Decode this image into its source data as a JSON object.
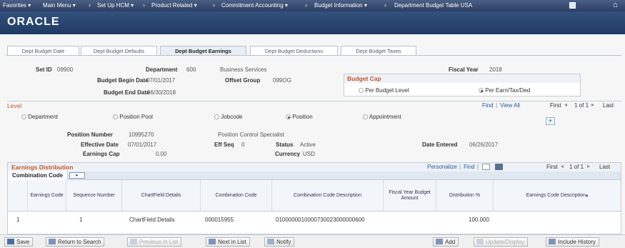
{
  "nav": {
    "favorites": "Favorites",
    "main_menu": "Main Menu",
    "setup_hcm": "Set Up HCM",
    "product_related": "Product Related",
    "commitment_accounting": "Commitment Accounting",
    "budget_information": "Budget Information",
    "department_budget_table": "Department Budget Table USA"
  },
  "brand": {
    "logo": "ORACLE"
  },
  "tabs": [
    "Dept Budget Date",
    "Dept Budget Defaults",
    "Dept Budget Earnings",
    "Dept Budget Deductions",
    "Dept Budget Taxes"
  ],
  "header": {
    "setid_label": "Set ID",
    "setid_value": "09900",
    "department_label": "Department",
    "department_value": "600",
    "department_desc": "Business Services",
    "fiscal_year_label": "Fiscal Year",
    "fiscal_year_value": "2018",
    "begin_date_label": "Budget Begin Date",
    "begin_date_value": "07/01/2017",
    "offset_group_label": "Offset Group",
    "offset_group_value": "099OG",
    "end_date_label": "Budget End Date",
    "end_date_value": "06/30/2018"
  },
  "budget_cap": {
    "title": "Budget Cap",
    "per_budget_level": "Per Budget Level",
    "per_earn_tax_ded": "Per Earn/Tax/Ded",
    "selected": "per_earn_tax_ded"
  },
  "level": {
    "title": "Level",
    "find": "Find",
    "view_all": "View All",
    "first": "First",
    "pagination": "1 of 1",
    "last": "Last",
    "options": [
      "Department",
      "Position Pool",
      "Jobcode",
      "Position",
      "Appointment"
    ],
    "selected": "Position",
    "position_number_label": "Position Number",
    "position_number_value": "10995270",
    "position_desc": "Position Control Specialist",
    "effective_date_label": "Effective Date",
    "effective_date_value": "07/01/2017",
    "eff_seq_label": "Eff Seq",
    "eff_seq_value": "0",
    "status_label": "Status",
    "status_value": "Active",
    "date_entered_label": "Date Entered",
    "date_entered_value": "06/26/2017",
    "earnings_cap_label": "Earnings Cap",
    "earnings_cap_value": "0.00",
    "currency_label": "Currency",
    "currency_value": "USD"
  },
  "earnings_distribution": {
    "title": "Earnings Distribution",
    "personalize": "Personalize",
    "find": "Find",
    "first": "First",
    "pagination": "1 of 1",
    "last": "Last",
    "subtab": "Combination Code",
    "columns": [
      "Earnings Code",
      "Sequence Number",
      "ChartField Details",
      "Combination Code",
      "Combination Code Description",
      "Fiscal Year Budget Amount",
      "Distribution %",
      "Earnings Code Description"
    ],
    "rows": [
      {
        "row_num": "1",
        "earnings_code": "",
        "sequence": "1",
        "chartfield_details": "ChartField Details",
        "combination_code": "000015955",
        "description": "0100000010000730023000000600",
        "budget_amount": "",
        "distribution": "100.000",
        "earn_desc": ""
      }
    ]
  },
  "toolbar": {
    "save": "Save",
    "return_to_search": "Return to Search",
    "previous_in_list": "Previous in List",
    "next_in_list": "Next in List",
    "notify": "Notify",
    "add": "Add",
    "update_display": "Update/Display",
    "include_history": "Include History"
  },
  "colors": {
    "nav_bg": "#2c3e62",
    "section_title": "#c0562c",
    "link": "#2355a0"
  }
}
